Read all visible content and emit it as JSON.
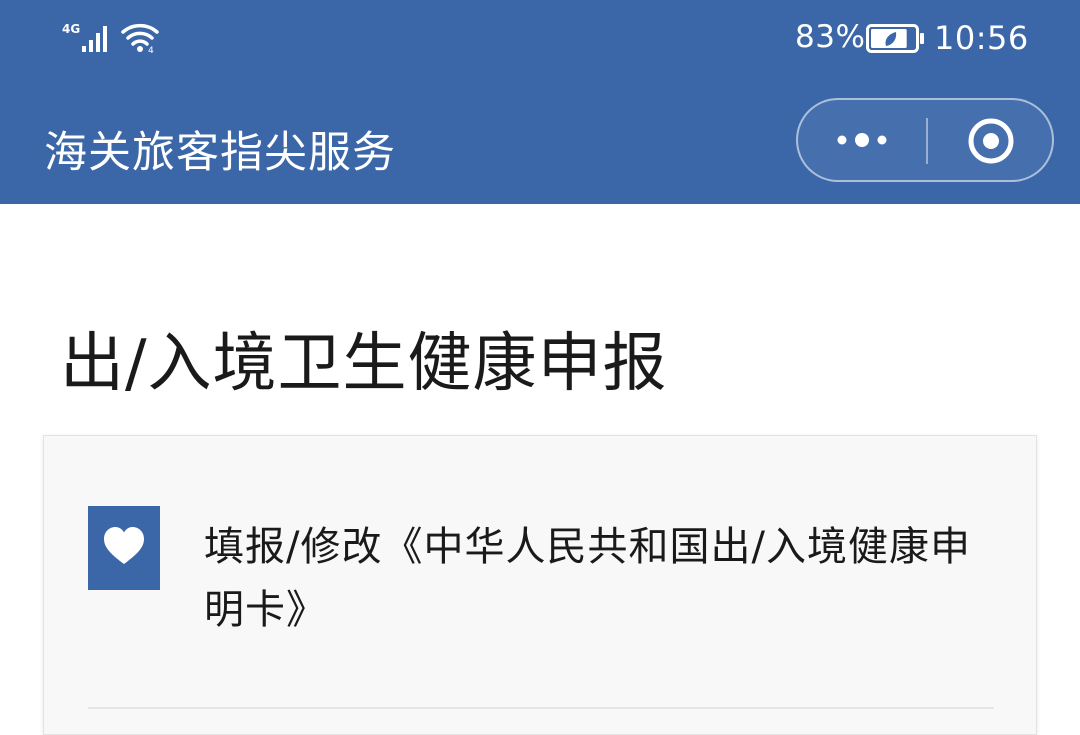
{
  "status_bar": {
    "network_label": "4G",
    "battery_percent": "83%",
    "battery_level": 0.83,
    "time": "10:56"
  },
  "app": {
    "title": "海关旅客指尖服务",
    "more_icon": "more-dots-icon",
    "close_icon": "close-target-icon",
    "theme_color": "#3b67a9"
  },
  "page": {
    "title": "出/入境卫生健康申报"
  },
  "card": {
    "item_icon": "heart-icon",
    "item_label": "填报/修改《中华人民共和国出/入境健康申明卡》"
  }
}
